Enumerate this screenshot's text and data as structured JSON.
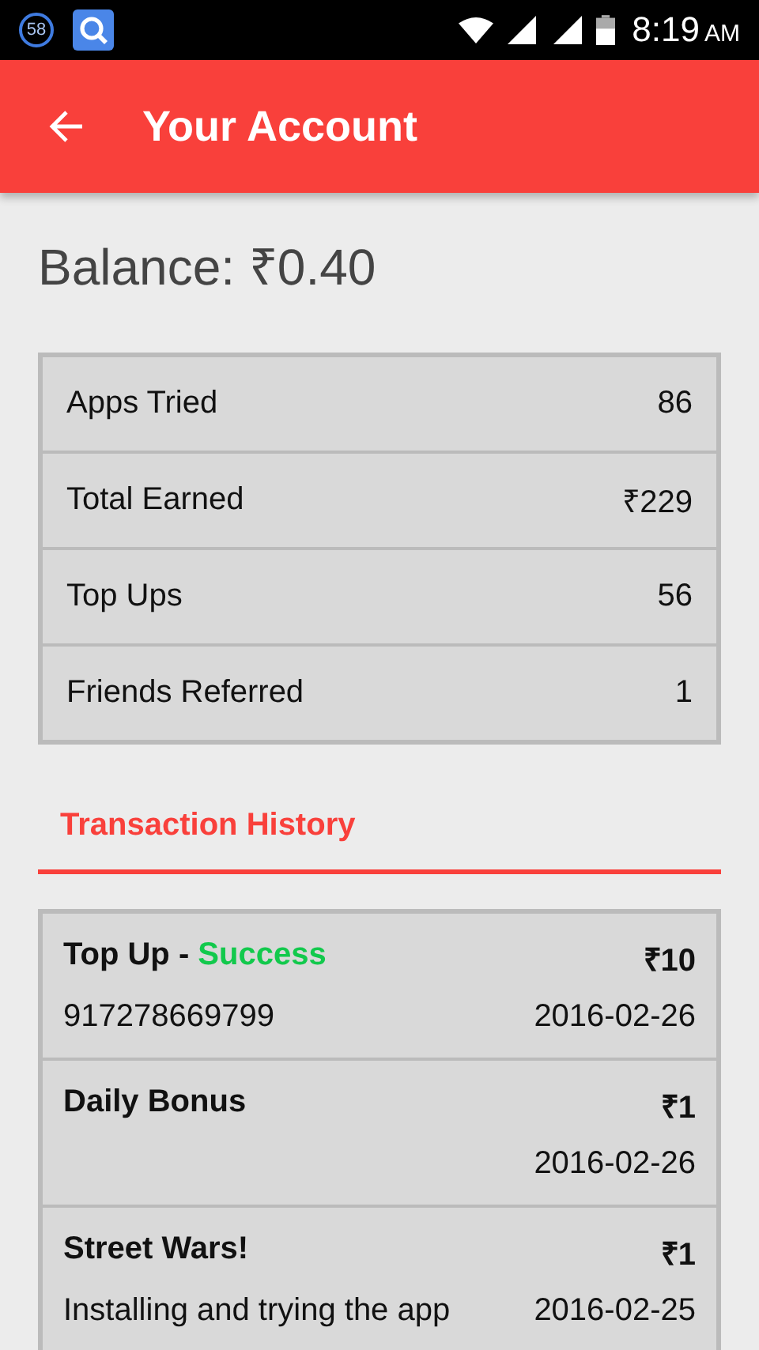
{
  "status_bar": {
    "notification_count": "58",
    "time": "8:19",
    "meridiem": "AM"
  },
  "app_bar": {
    "title": "Your Account"
  },
  "balance": "Balance: ₹0.40",
  "stats": [
    {
      "label": "Apps Tried",
      "value": "86"
    },
    {
      "label": "Total Earned",
      "value": "₹229"
    },
    {
      "label": "Top Ups",
      "value": "56"
    },
    {
      "label": "Friends Referred",
      "value": "1"
    }
  ],
  "history_title": "Transaction History",
  "transactions": [
    {
      "title": "Top Up - ",
      "status": "Success",
      "color": "#12c94c",
      "amount": "₹10",
      "detail": "917278669799",
      "date": "2016-02-26"
    },
    {
      "title": "Daily Bonus",
      "amount": "₹1",
      "date": "2016-02-26"
    },
    {
      "title": "Street Wars!",
      "amount": "₹1",
      "detail": "Installing and trying the app",
      "date": "2016-02-25"
    }
  ]
}
